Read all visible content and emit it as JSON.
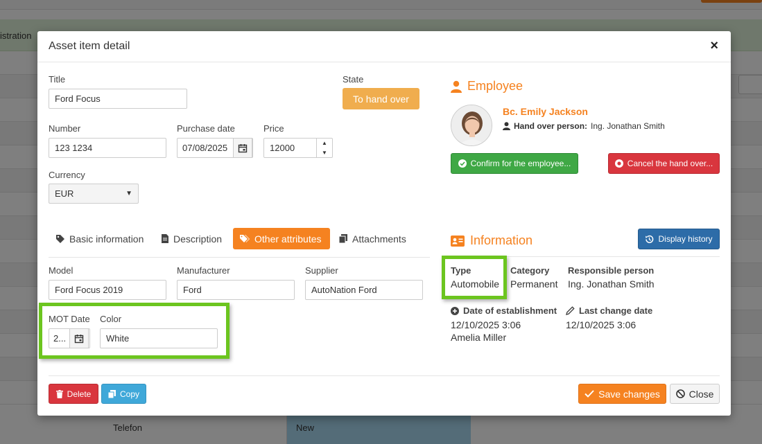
{
  "background": {
    "green_row_text": "istration",
    "bottom_cell1": "Telefon",
    "bottom_cell2": "New"
  },
  "modal": {
    "title": "Asset item detail",
    "close_symbol": "×"
  },
  "form": {
    "title_label": "Title",
    "title_value": "Ford Focus",
    "state_label": "State",
    "state_button": "To hand over",
    "number_label": "Number",
    "number_value": "123 1234",
    "purchase_date_label": "Purchase date",
    "purchase_date_value": "07/08/2025",
    "price_label": "Price",
    "price_value": "12000",
    "currency_label": "Currency",
    "currency_value": "EUR"
  },
  "employee": {
    "section_title": "Employee",
    "name": "Bc. Emily Jackson",
    "handover_label": "Hand over person:",
    "handover_value": "Ing. Jonathan Smith",
    "confirm_button": "Confirm for the employee...",
    "cancel_button": "Cancel the hand over..."
  },
  "tabs": [
    {
      "label": "Basic information",
      "icon": "tag-icon"
    },
    {
      "label": "Description",
      "icon": "document-icon"
    },
    {
      "label": "Other attributes",
      "icon": "tags-icon",
      "active": true
    },
    {
      "label": "Attachments",
      "icon": "copy-icon"
    }
  ],
  "attributes": {
    "model_label": "Model",
    "model_value": "Ford Focus 2019",
    "manufacturer_label": "Manufacturer",
    "manufacturer_value": "Ford",
    "supplier_label": "Supplier",
    "supplier_value": "AutoNation Ford",
    "mot_date_label": "MOT Date",
    "mot_date_value": "2...",
    "color_label": "Color",
    "color_value": "White"
  },
  "information": {
    "section_title": "Information",
    "history_button": "Display history",
    "type_label": "Type",
    "type_value": "Automobile",
    "category_label": "Category",
    "category_value": "Permanent",
    "responsible_label": "Responsible person",
    "responsible_value": "Ing. Jonathan Smith",
    "established_label": "Date of establishment",
    "established_date": "12/10/2025 3:06",
    "established_by": "Amelia Miller",
    "last_change_label": "Last change date",
    "last_change_date": "12/10/2025 3:06"
  },
  "footer": {
    "delete_button": "Delete",
    "copy_button": "Copy",
    "save_button": "Save changes",
    "close_button": "Close"
  },
  "colors": {
    "accent": "#f58220",
    "highlight": "#6cc51f",
    "success": "#3fa845",
    "danger": "#d9363e",
    "primary": "#2d6ca8",
    "info": "#3fa8d9",
    "warning": "#f0ad4e"
  }
}
